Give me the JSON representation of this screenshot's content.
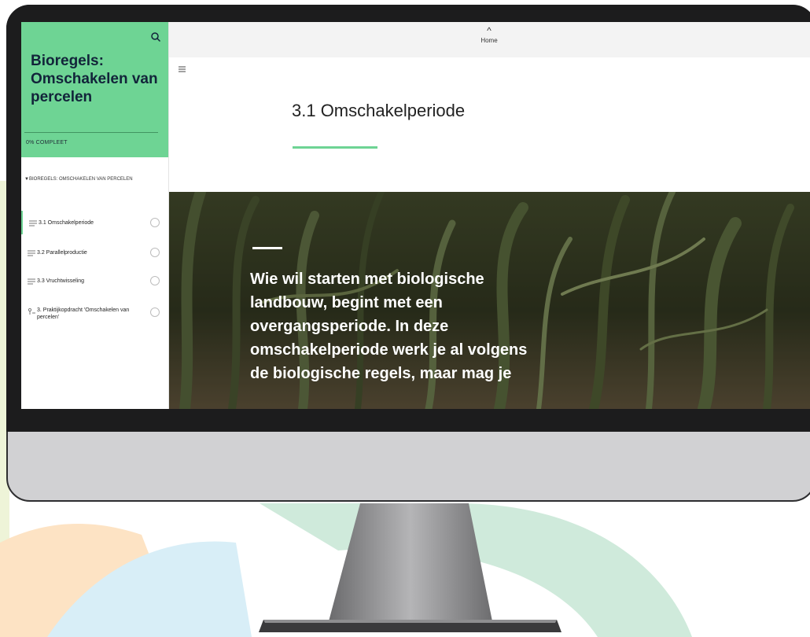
{
  "sidebar": {
    "course_title": "Bioregels: Omschakelen van percelen",
    "progress": "0% COMPLEET",
    "section_label": "BIOREGELS: OMSCHAKELEN VAN PERCELEN",
    "lessons": [
      {
        "label": "3.1 Omschakelperiode",
        "active": true,
        "icon": "lines-icon"
      },
      {
        "label": "3.2 Parallelproductie",
        "active": false,
        "icon": "lines-icon"
      },
      {
        "label": "3.3 Vruchtwisseling",
        "active": false,
        "icon": "lines-icon"
      },
      {
        "label": "3. Praktijkopdracht 'Omschakelen van percelen'",
        "active": false,
        "icon": "assignment-icon"
      }
    ]
  },
  "topbar": {
    "home_label": "Home"
  },
  "main": {
    "lesson_title": "3.1 Omschakelperiode",
    "hero_text": "Wie wil starten met biologische landbouw, begint met een overgangsperiode. In deze omschakelperiode werk je al volgens de biologische regels, maar mag je"
  },
  "colors": {
    "accent_green": "#6ed494",
    "title_navy": "#12243a",
    "bg_peach": "#fde3c4",
    "bg_blue": "#d8eef7",
    "bg_mint": "#cfeadb"
  }
}
